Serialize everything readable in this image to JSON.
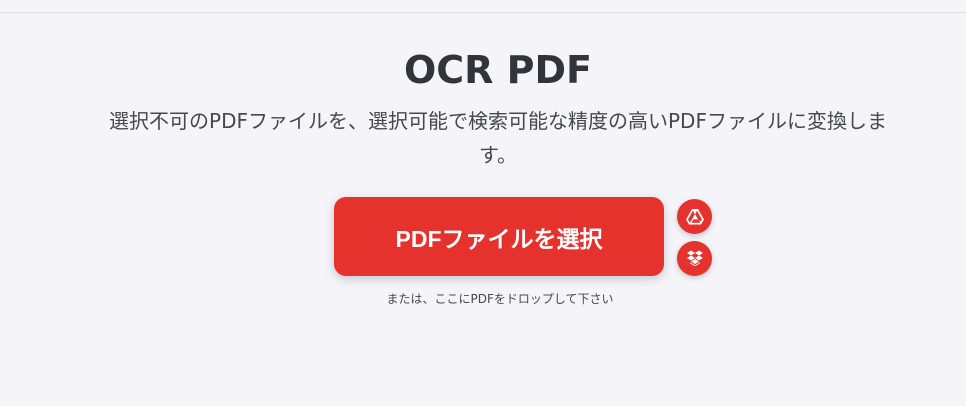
{
  "header": {
    "title": "OCR PDF",
    "subtitle": "選択不可のPDFファイルを、選択可能で検索可能な精度の高いPDFファイルに変換します。"
  },
  "upload": {
    "select_label": "PDFファイルを選択",
    "drop_hint": "または、ここにPDFをドロップして下さい",
    "cloud_icons": [
      "google-drive-icon",
      "dropbox-icon"
    ]
  },
  "colors": {
    "accent": "#e5322d",
    "background": "#f4f4f9",
    "text": "#33333b"
  }
}
